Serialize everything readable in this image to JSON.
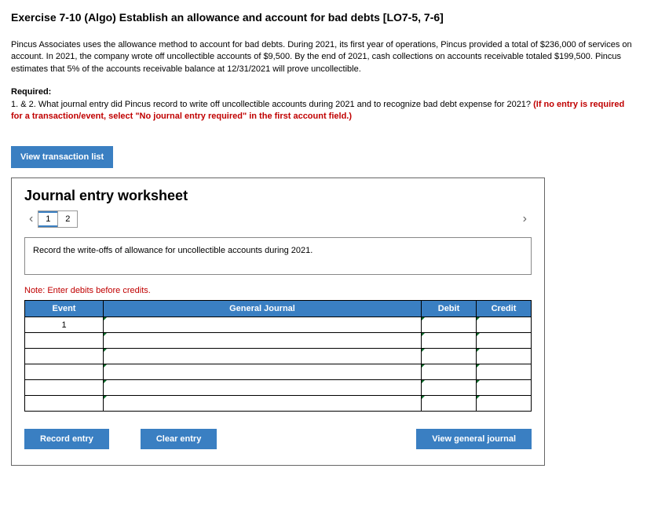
{
  "title": "Exercise 7-10 (Algo) Establish an allowance and account for bad debts [LO7-5, 7-6]",
  "paragraph": "Pincus Associates uses the allowance method to account for bad debts. During 2021, its first year of operations, Pincus provided a total of $236,000 of services on account. In 2021, the company wrote off uncollectible accounts of $9,500. By the end of 2021, cash collections on accounts receivable totaled $199,500. Pincus estimates that 5% of the accounts receivable balance at 12/31/2021 will prove uncollectible.",
  "required_label": "Required:",
  "required_text1": "1. & 2. What journal entry did Pincus record to write off uncollectible accounts during 2021 and to recognize bad debt expense for 2021? ",
  "required_red": "(If no entry is required for a transaction/event, select \"No journal entry required\" in the first account field.)",
  "view_list": "View transaction list",
  "worksheet": {
    "title": "Journal entry worksheet",
    "tab1": "1",
    "tab2": "2",
    "instruction": "Record the write-offs of allowance for uncollectible accounts during 2021.",
    "note": "Note: Enter debits before credits.",
    "headers": {
      "event": "Event",
      "gj": "General Journal",
      "debit": "Debit",
      "credit": "Credit"
    },
    "rows": [
      "1",
      "",
      "",
      "",
      "",
      ""
    ],
    "buttons": {
      "record": "Record entry",
      "clear": "Clear entry",
      "view": "View general journal"
    }
  }
}
